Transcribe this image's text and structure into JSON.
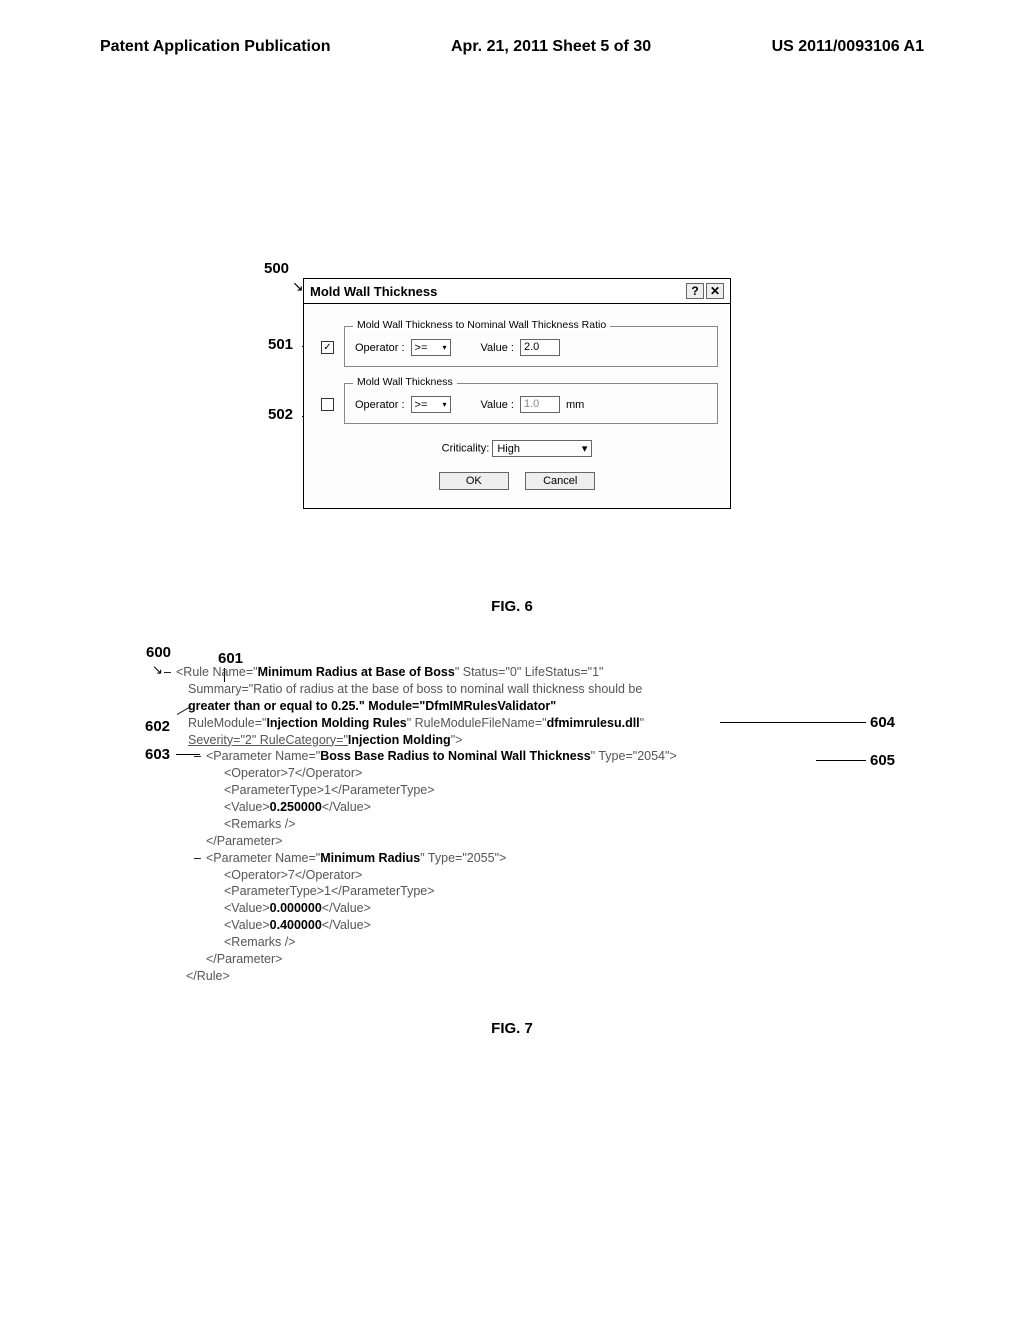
{
  "header": {
    "left": "Patent Application Publication",
    "mid": "Apr. 21, 2011  Sheet 5 of 30",
    "right": "US 2011/0093106 A1"
  },
  "refs": {
    "r500": "500",
    "r501": "501",
    "r502": "502",
    "r600": "600",
    "r601": "601",
    "r602": "602",
    "r603": "603",
    "r604": "604",
    "r605": "605"
  },
  "dialog": {
    "title": "Mold Wall Thickness",
    "help": "?",
    "close": "✕",
    "group1": {
      "legend": "Mold Wall Thickness to Nominal Wall Thickness Ratio",
      "checked": true,
      "operator_label": "Operator :",
      "operator_value": ">=",
      "value_label": "Value :",
      "value": "2.0"
    },
    "group2": {
      "legend": "Mold Wall Thickness",
      "checked": false,
      "operator_label": "Operator :",
      "operator_value": ">=",
      "value_label": "Value :",
      "value": "1.0",
      "unit": "mm"
    },
    "criticality_label": "Criticality:",
    "criticality_value": "High",
    "ok": "OK",
    "cancel": "Cancel"
  },
  "fig6": "FIG. 6",
  "fig7": "FIG. 7",
  "xml": {
    "l1a": "<Rule Name=\"",
    "l1b": "Minimum Radius at Base of Boss",
    "l1c": "\" Status=\"0\" LifeStatus=\"1\"",
    "l2a": "Summary=\"Ratio of radius at the base of boss to nominal wall thickness should be",
    "l3a": "greater than or equal to 0.25.\" Module=\"DfmIMRulesValidator\"",
    "l4a": "RuleModule=\"",
    "l4b": "Injection Molding Rules",
    "l4c": "\" RuleModuleFileName=\"",
    "l4d": "dfmimrulesu.dll",
    "l4e": "\"",
    "l5a": "Severity=\"2\" RuleCategory=\"",
    "l5b": "Injection Molding",
    "l5c": "\">",
    "l6a": "<Parameter Name=\"",
    "l6b": "Boss Base Radius to Nominal Wall Thickness",
    "l6c": "\" Type=\"2054\">",
    "l7": "<Operator>7</Operator>",
    "l8": "<ParameterType>1</ParameterType>",
    "l9a": "<Value>",
    "l9b": "0.250000",
    "l9c": "</Value>",
    "l10": "<Remarks />",
    "l11": "</Parameter>",
    "l12a": "<Parameter Name=\"",
    "l12b": "Minimum Radius",
    "l12c": "\" Type=\"2055\">",
    "l13": "<Operator>7</Operator>",
    "l14": "<ParameterType>1</ParameterType>",
    "l15a": "<Value>",
    "l15b": "0.000000",
    "l15c": "</Value>",
    "l16a": "<Value>",
    "l16b": "0.400000",
    "l16c": "</Value>",
    "l17": "<Remarks />",
    "l18": "</Parameter>",
    "l19": "</Rule>"
  }
}
